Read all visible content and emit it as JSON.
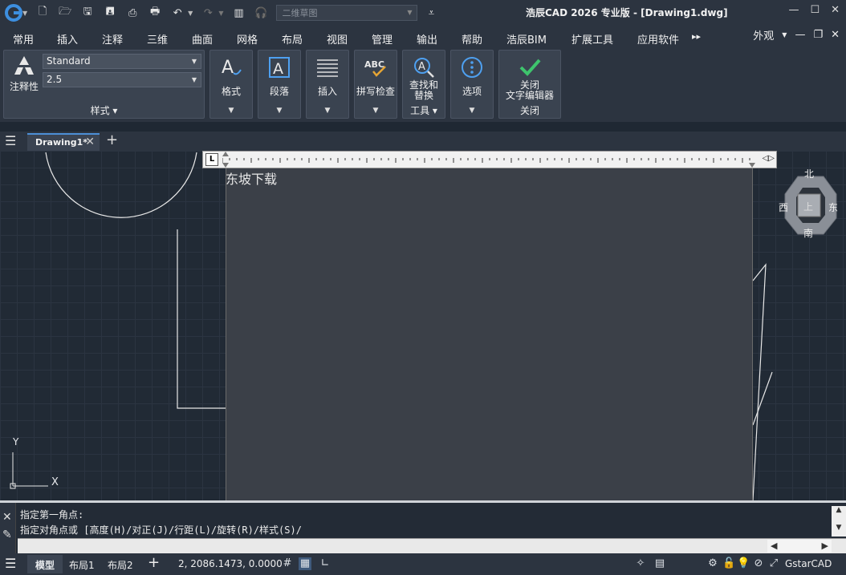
{
  "titlebar": {
    "title": "浩辰CAD 2026 专业版 - [Drawing1.dwg]",
    "workspace_placeholder": "二维草图"
  },
  "menu": {
    "tabs": [
      "常用",
      "插入",
      "注释",
      "三维",
      "曲面",
      "网格",
      "布局",
      "视图",
      "管理",
      "输出",
      "帮助",
      "浩辰BIM",
      "扩展工具",
      "应用软件"
    ],
    "overflow": "▸▸",
    "appearance": "外观"
  },
  "ribbon": {
    "annotative_label": "注释性",
    "style_value": "Standard",
    "height_value": "2.5",
    "style_group_label": "样式 ▾",
    "format_label": "格式",
    "paragraph_label": "段落",
    "insert_label": "插入",
    "spellcheck_label": "拼写检查",
    "find_label_1": "查找和",
    "find_label_2": "替换",
    "tools_group_label": "工具 ▾",
    "options_label": "选项",
    "close_label_1": "关闭",
    "close_label_2": "文字编辑器",
    "close_group_label": "关闭",
    "down_arrow": "▼"
  },
  "filetabs": {
    "active_tab": "Drawing1*",
    "add": "+"
  },
  "canvas": {
    "typed_text": "东坡下载",
    "ruler_left": "L",
    "ruler_right": "◁▷",
    "compass": {
      "north": "北",
      "south": "南",
      "east": "东",
      "west": "西",
      "top": "上"
    },
    "ucs_y": "Y",
    "ucs_x": "X"
  },
  "command": {
    "line1": "指定第一角点:",
    "line2": "指定对角点或 [高度(H)/对正(J)/行距(L)/旋转(R)/样式(S)/"
  },
  "status": {
    "model": "模型",
    "layout1": "布局1",
    "layout2": "布局2",
    "add": "+",
    "coords": "2, 2086.1473, 0.0000",
    "brand": "GstarCAD"
  },
  "icons": [
    "logo-icon",
    "new-icon",
    "open-icon",
    "save-icon",
    "saveas-icon",
    "print-icon",
    "undo-icon",
    "redo-icon",
    "gear-icon"
  ]
}
